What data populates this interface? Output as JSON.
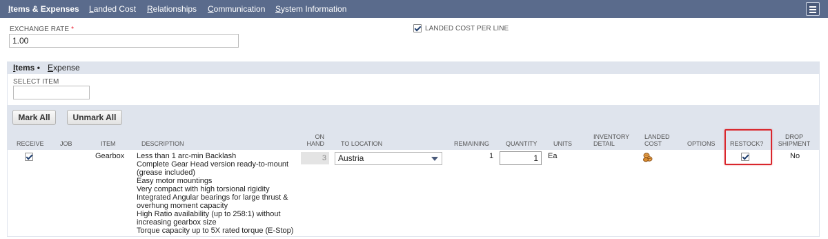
{
  "tabs": [
    {
      "label": "Items & Expenses",
      "underline": "I",
      "rest": "tems & Expenses",
      "active": true
    },
    {
      "label": "Landed Cost",
      "underline": "L",
      "rest": "anded Cost"
    },
    {
      "label": "Relationships",
      "underline": "R",
      "rest": "elationships"
    },
    {
      "label": "Communication",
      "underline": "C",
      "rest": "ommunication"
    },
    {
      "label": "System Information",
      "underline": "S",
      "rest": "ystem Information"
    }
  ],
  "exchange_rate": {
    "label": "EXCHANGE RATE",
    "required_mark": "*",
    "value": "1.00"
  },
  "landed_cost_per_line": {
    "label": "LANDED COST PER LINE",
    "checked": true
  },
  "subtabs": [
    {
      "label": "Items",
      "underline": "I",
      "rest": "tems",
      "suffix": " •",
      "active": true
    },
    {
      "label": "Expense",
      "underline": "E",
      "rest": "xpense"
    }
  ],
  "select_item": {
    "label": "SELECT ITEM",
    "value": ""
  },
  "buttons": {
    "mark_all": "Mark All",
    "unmark_all": "Unmark All"
  },
  "columns": {
    "receive": "RECEIVE",
    "job": "JOB",
    "item": "ITEM",
    "description": "DESCRIPTION",
    "on_hand_1": "ON",
    "on_hand_2": "HAND",
    "to_location": "TO LOCATION",
    "remaining": "REMAINING",
    "quantity": "QUANTITY",
    "units": "UNITS",
    "inventory_detail_1": "INVENTORY",
    "inventory_detail_2": "DETAIL",
    "landed_cost_1": "LANDED",
    "landed_cost_2": "COST",
    "options": "OPTIONS",
    "restock": "RESTOCK?",
    "drop_shipment_1": "DROP",
    "drop_shipment_2": "SHIPMENT"
  },
  "row": {
    "receive": true,
    "job": "",
    "item": "Gearbox",
    "description": [
      "Less than 1 arc-min Backlash",
      "Complete Gear Head version ready-to-mount",
      "(grease included)",
      "Easy motor mountings",
      "Very compact with high torsional rigidity",
      "Integrated Angular bearings for large thrust &",
      "overhung moment capacity",
      "High Ratio availability (up to 258:1) without",
      "increasing gearbox size",
      "Torque capacity up to 5X rated torque (E-Stop)"
    ],
    "on_hand": "3",
    "to_location": "Austria",
    "remaining": "1",
    "quantity": "1",
    "units": "Ea",
    "landed_cost_icon": "coins-icon",
    "restock": true,
    "drop_shipment": "No"
  },
  "colors": {
    "tab_bar": "#5a6b8c",
    "strip": "#dfe4ed",
    "highlight": "#d9262c"
  }
}
